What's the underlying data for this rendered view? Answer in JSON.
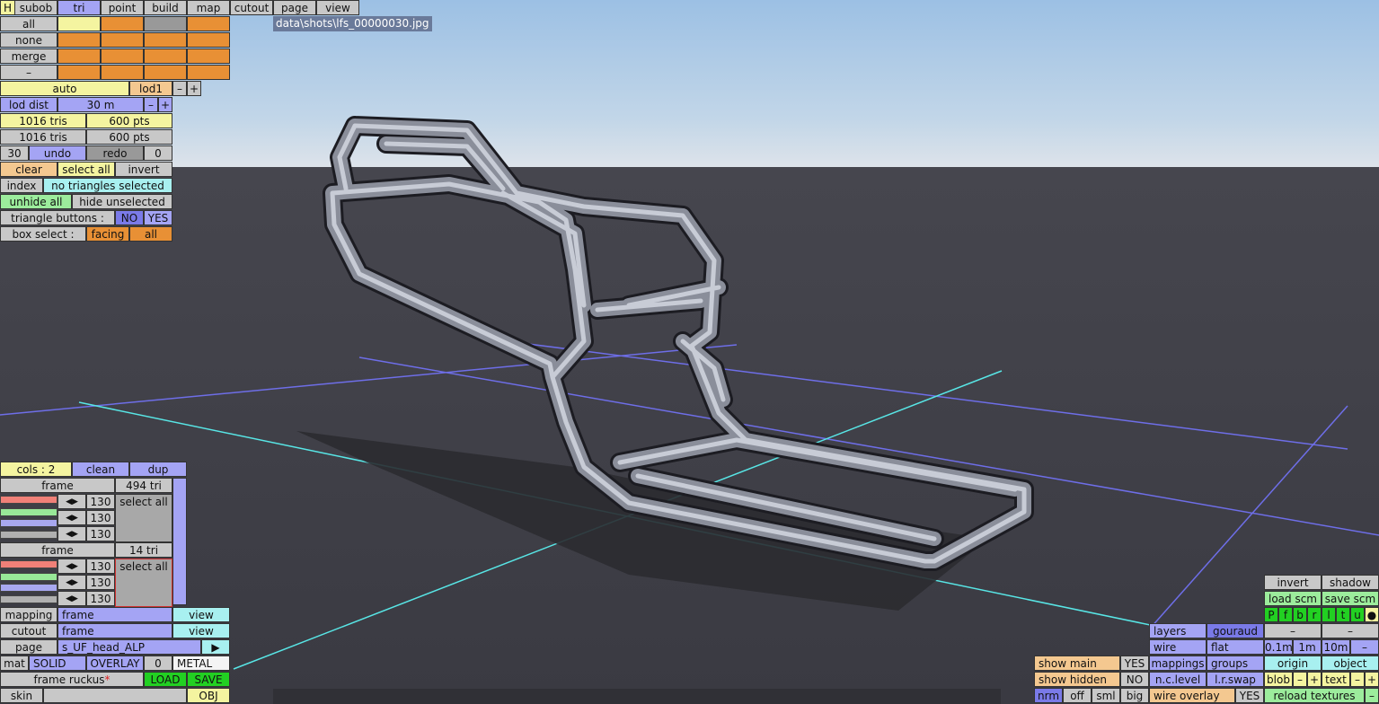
{
  "file": "data\\shots\\lfs_00000030.jpg",
  "tabs": [
    "H",
    "subob",
    "tri",
    "point",
    "build",
    "map",
    "cutout",
    "page",
    "view"
  ],
  "sel": {
    "all": "all",
    "none": "none",
    "merge": "merge",
    "dash": "–"
  },
  "auto": "auto",
  "lod": "lod1",
  "minus": "–",
  "plus": "+",
  "lod_dist": "lod dist",
  "lod_val": "30 m",
  "tris1": "1016 tris",
  "pts1": "600 pts",
  "tris2": "1016 tris",
  "pts2": "600 pts",
  "undo_n": "30",
  "undo": "undo",
  "redo": "redo",
  "redo_n": "0",
  "clear": "clear",
  "select_all": "select all",
  "invert": "invert",
  "index": "index",
  "no_tri": "no triangles selected",
  "unhide": "unhide all",
  "hide_unsel": "hide unselected",
  "tri_buttons": "triangle buttons :",
  "no": "NO",
  "yes": "YES",
  "box_select": "box select :",
  "facing": "facing",
  "all2": "all",
  "cols": "cols : 2",
  "clean": "clean",
  "dup": "dup",
  "frame1": "frame",
  "frame1_tri": "494 tri",
  "frame2": "frame",
  "frame2_tri": "14 tri",
  "v130": "130",
  "sel_all": "select all",
  "arrL": "◀",
  "arrR": "▶",
  "mapping": "mapping",
  "mapping_val": "frame",
  "view": "view",
  "cutout": "cutout",
  "cutout_val": "frame",
  "page": "page",
  "page_val": "s_UF_head_ALP",
  "mat": "mat",
  "solid": "SOLID",
  "overlay": "OVERLAY",
  "zero": "0",
  "metal": "METAL",
  "frame_ruckus": "frame ruckus",
  "star": "*",
  "load": "LOAD",
  "save": "SAVE",
  "skin": "skin",
  "obj": "OBJ",
  "r_invert": "invert",
  "shadow": "shadow",
  "load_scm": "load scm",
  "save_scm": "save scm",
  "flags": [
    "P",
    "f",
    "b",
    "r",
    "l",
    "t",
    "u",
    "●"
  ],
  "layers": "layers",
  "gouraud": "gouraud",
  "wire": "wire",
  "flat": "flat",
  "d01": "0.1m",
  "d1": "1m",
  "d10": "10m",
  "show_main": "show main",
  "show_hidden": "show hidden",
  "mappings": "mappings",
  "groups": "groups",
  "origin": "origin",
  "object": "object",
  "nclevel": "n.c.level",
  "lrswap": "l.r.swap",
  "blob": "blob",
  "text": "text",
  "nrm": "nrm",
  "off": "off",
  "sml": "sml",
  "big": "big",
  "wire_overlay": "wire overlay",
  "reload": "reload textures"
}
